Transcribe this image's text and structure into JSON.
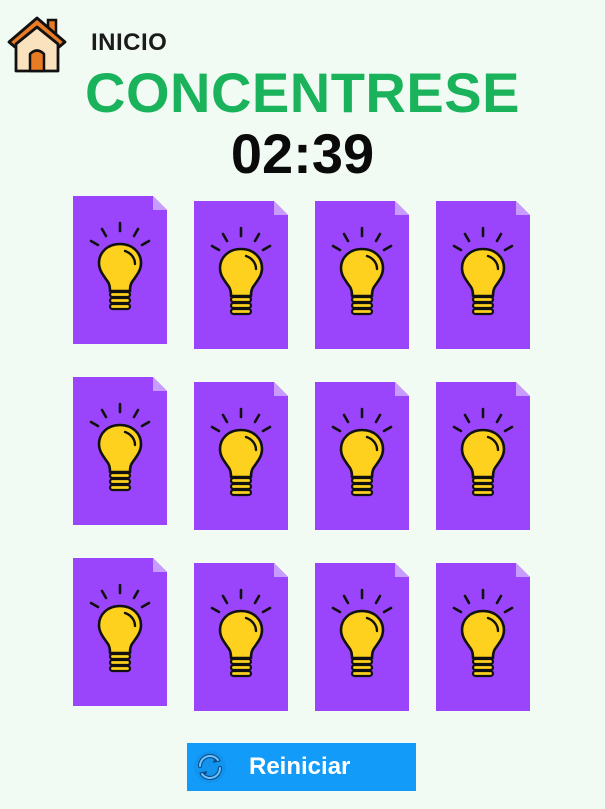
{
  "nav": {
    "home_icon": "house-icon",
    "home_label": "INICIO"
  },
  "game": {
    "title": "CONCENTRESE",
    "timer": "02:39",
    "cards": [
      {
        "state": "face-down",
        "icon": "lightbulb-icon"
      },
      {
        "state": "face-down",
        "icon": "lightbulb-icon"
      },
      {
        "state": "face-down",
        "icon": "lightbulb-icon"
      },
      {
        "state": "face-down",
        "icon": "lightbulb-icon"
      },
      {
        "state": "face-down",
        "icon": "lightbulb-icon"
      },
      {
        "state": "face-down",
        "icon": "lightbulb-icon"
      },
      {
        "state": "face-down",
        "icon": "lightbulb-icon"
      },
      {
        "state": "face-down",
        "icon": "lightbulb-icon"
      },
      {
        "state": "face-down",
        "icon": "lightbulb-icon"
      },
      {
        "state": "face-down",
        "icon": "lightbulb-icon"
      },
      {
        "state": "face-down",
        "icon": "lightbulb-icon"
      },
      {
        "state": "face-down",
        "icon": "lightbulb-icon"
      }
    ]
  },
  "controls": {
    "reset_label": "Reiniciar",
    "reset_icon": "refresh-icon"
  },
  "colors": {
    "background": "#f1fbf3",
    "title": "#1ab35c",
    "card": "#9a45fb",
    "card_fold": "#c89cff",
    "bulb": "#fdd11d",
    "button": "#139bfa"
  }
}
